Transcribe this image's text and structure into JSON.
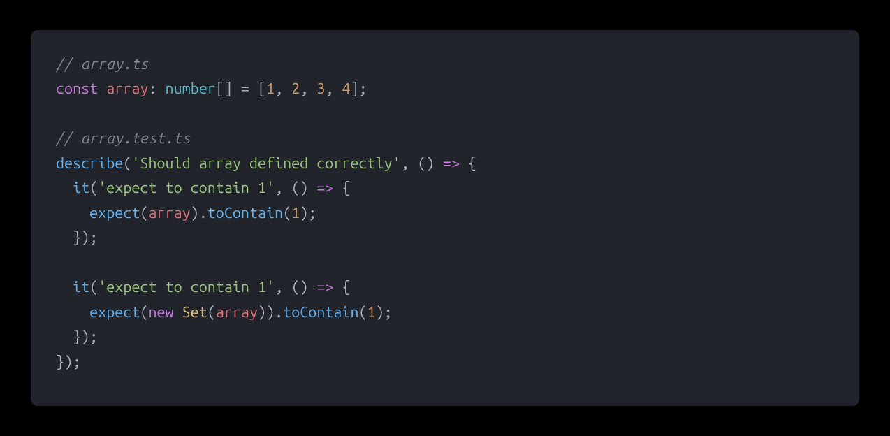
{
  "code": {
    "comment1": "// array.ts",
    "kw_const": "const",
    "ident_array_decl": "array",
    "colon": ":",
    "type_number": "number",
    "brackets": "[]",
    "eq": " = ",
    "open_arr": "[",
    "num1": "1",
    "comma": ", ",
    "num2": "2",
    "num3": "3",
    "num4": "4",
    "close_arr": "]",
    "semi": ";",
    "comment2": "// array.test.ts",
    "fn_describe": "describe",
    "paren_open": "(",
    "str_describe": "'Should array defined correctly'",
    "comma2": ", ",
    "paren_empty": "()",
    "arrow": " => ",
    "brace_open": "{",
    "fn_it": "it",
    "str_it1": "'expect to contain 1'",
    "fn_expect": "expect",
    "ident_array_use": "array",
    "paren_close": ")",
    "dot": ".",
    "method_toContain": "toContain",
    "arg1": "1",
    "brace_close": "}",
    "str_it2": "'expect to contain 1'",
    "kw_new": "new",
    "space": " ",
    "ctor_Set": "Set"
  }
}
